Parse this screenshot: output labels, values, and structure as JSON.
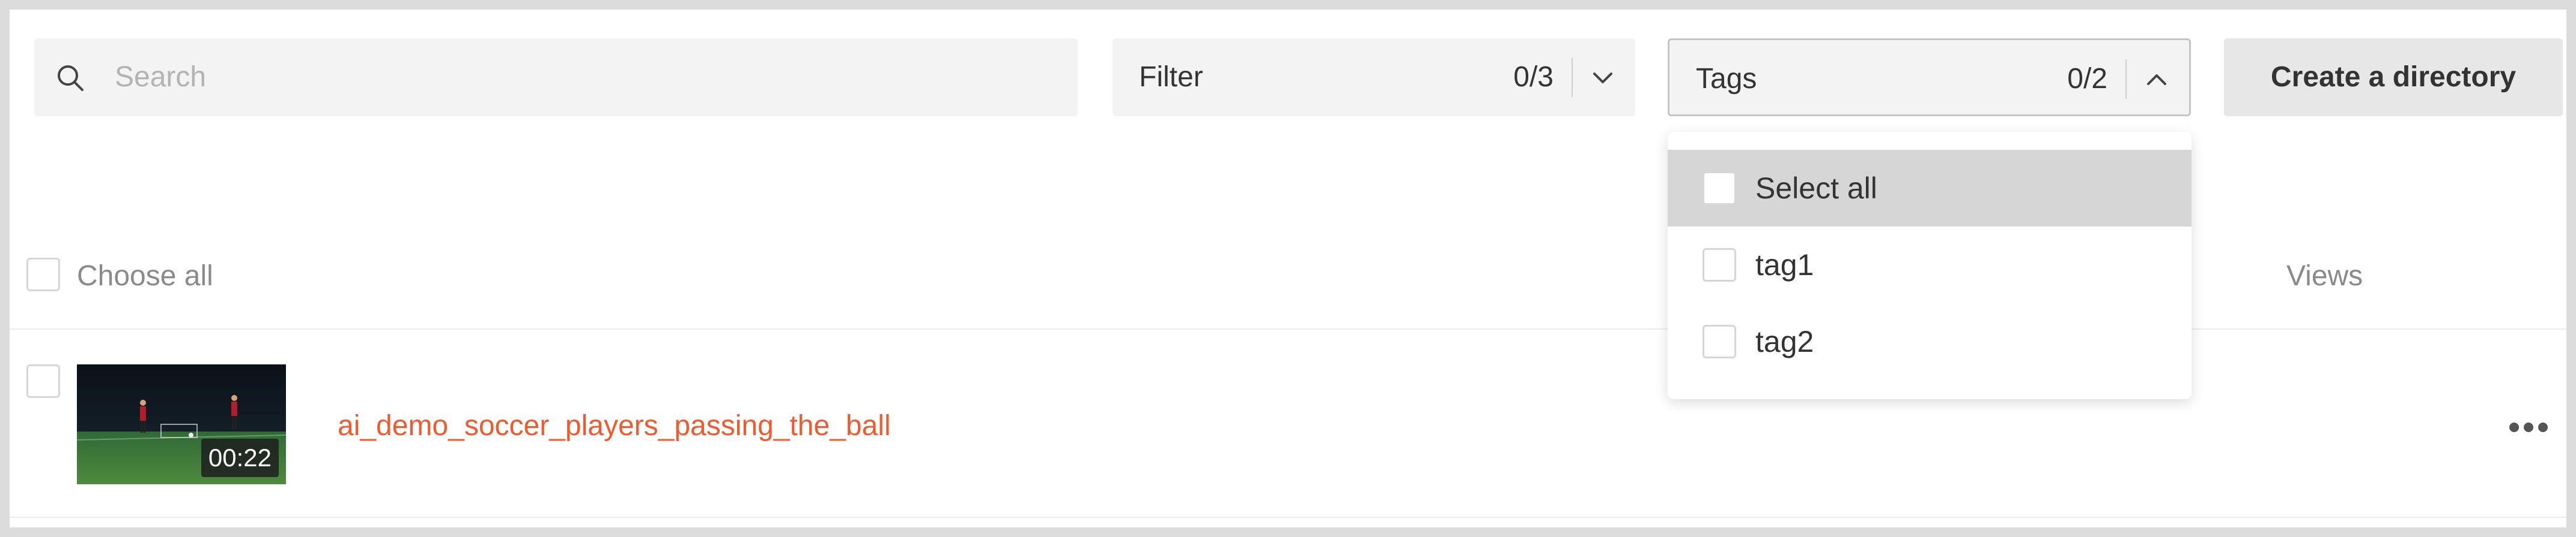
{
  "toolbar": {
    "search_placeholder": "Search",
    "filter": {
      "label": "Filter",
      "count": "0/3"
    },
    "tags": {
      "label": "Tags",
      "count": "0/2"
    },
    "create_directory_label": "Create a directory"
  },
  "table": {
    "choose_all_label": "Choose all",
    "views_header": "Views",
    "rows": [
      {
        "title": "ai_demo_soccer_players_passing_the_ball",
        "duration": "00:22"
      }
    ]
  },
  "tags_dropdown": {
    "items": [
      {
        "label": "Select all"
      },
      {
        "label": "tag1"
      },
      {
        "label": "tag2"
      }
    ]
  },
  "colors": {
    "accent_title": "#ef5a2e",
    "hover_item": "#d6d6d6"
  },
  "icons": [
    "search-icon",
    "chevron-down-icon",
    "chevron-up-icon",
    "more-options-icon"
  ]
}
